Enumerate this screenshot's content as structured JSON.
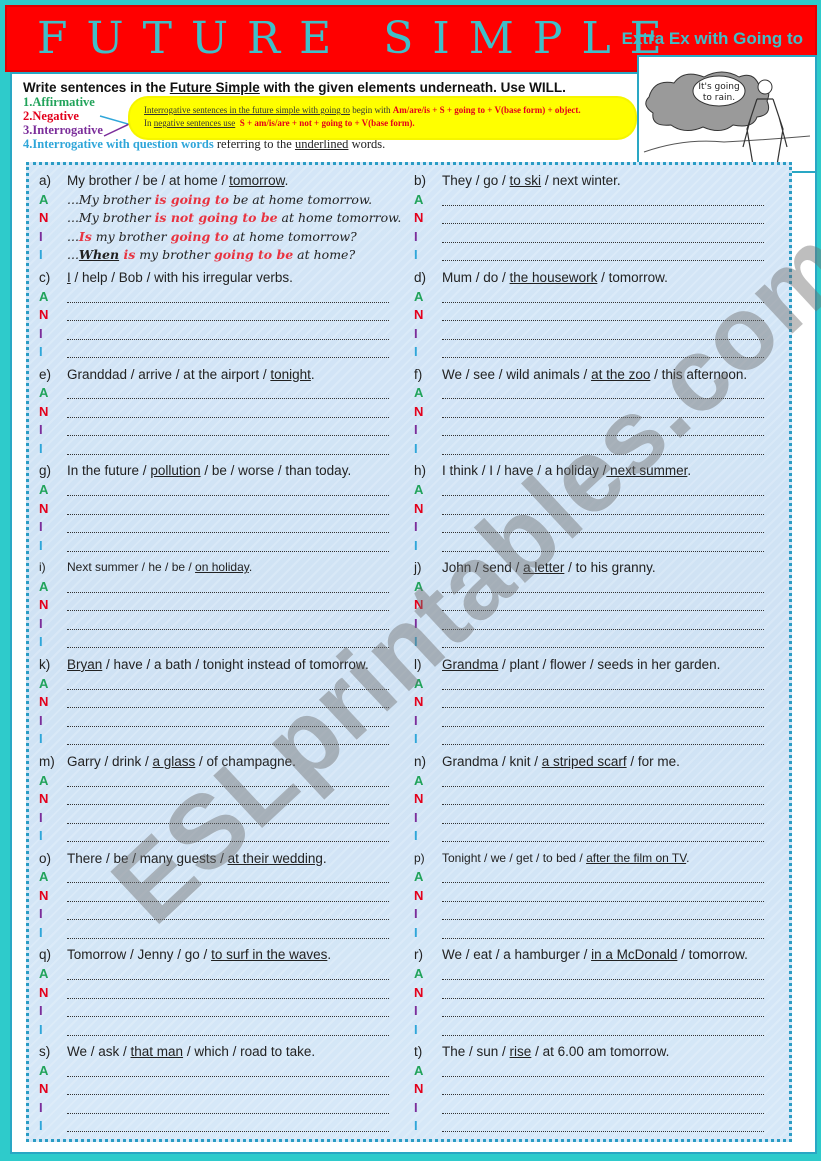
{
  "header": {
    "title": "FUTURE SIMPLE",
    "subtitle": "Extra Ex with Going to"
  },
  "picture": {
    "speech_bubble_line1": "It's going",
    "speech_bubble_line2": "to rain."
  },
  "instructions": {
    "main_prefix": "Write sentences in the ",
    "main_underlined": "Future Simple",
    "main_suffix": " with the given elements underneath. Use WILL.",
    "types": [
      {
        "label": "1.Affirmative",
        "color": "#21a35a"
      },
      {
        "label": "2.Negative",
        "color": "#e3001b"
      },
      {
        "label": "3.Interrogative",
        "color": "#7b2d9a"
      }
    ],
    "type4_label": "4.Interrogative with question words",
    "type4_suffix_pre": " referring to the ",
    "type4_underlined": "underlined",
    "type4_suffix_post": " words."
  },
  "note": {
    "line1_underlined": "Interrogative sentences in the future simple with going to",
    "line1_mid": " begin with ",
    "line1_formula": "Am/are/is + S + going to + V(base form) + object.",
    "line2_prefix": "In ",
    "line2_underlined": "negative sentences use",
    "line2_formula": "S + am/is/are + not + going to + V(base form)."
  },
  "labels": {
    "A": "A",
    "N": "N",
    "I": "I",
    "I2": "I",
    "colors": {
      "A": "#21a35a",
      "N": "#e3001b",
      "I": "#7b2d9a",
      "I2": "#2fa6d9"
    }
  },
  "example": {
    "letter": "a)",
    "prompt_pre": "My brother / be / at home / ",
    "prompt_underlined": "tomorrow",
    "prompt_post": ".",
    "answers": {
      "A": {
        "pre": "...My brother ",
        "red": "is going to",
        "post": " be at home tomorrow."
      },
      "N": {
        "pre": "...My brother ",
        "red": "is not going to be",
        "post": " at home tomorrow."
      },
      "I": {
        "pre": "...",
        "red": "Is",
        "mid": " my brother ",
        "red2": "going to",
        "post": "  at home tomorrow?"
      },
      "I2": {
        "pre": "...",
        "under": "When",
        "red": " is",
        "mid": " my brother ",
        "red2": "going to be",
        "post": " at home?"
      }
    }
  },
  "exercises": [
    {
      "letter": "b)",
      "pre": "They / go / ",
      "underlined": "to ski",
      "post": " / next winter."
    },
    {
      "letter": "c)",
      "pre": "",
      "underlined": "I",
      "post": " / help / Bob / with his irregular verbs."
    },
    {
      "letter": "d)",
      "pre": "Mum / do / ",
      "underlined": "the housework",
      "post": " / tomorrow."
    },
    {
      "letter": "e)",
      "pre": "Granddad / arrive / at the airport / ",
      "underlined": "tonight",
      "post": "."
    },
    {
      "letter": "f)",
      "pre": "We / see / wild animals / ",
      "underlined": "at the zoo",
      "post": " / this afternoon."
    },
    {
      "letter": "g)",
      "pre": "In the future / ",
      "underlined": "pollution",
      "post": " / be / worse / than today."
    },
    {
      "letter": "h)",
      "pre": "I think / I / have / a holiday /",
      "underlined": " next summer",
      "post": "."
    },
    {
      "letter": "i)",
      "pre": "Next summer / he / be / ",
      "underlined": "on holiday",
      "post": ".",
      "small": true
    },
    {
      "letter": "j)",
      "pre": "John / send / ",
      "underlined": "a letter",
      "post": " / to his granny."
    },
    {
      "letter": "k)",
      "pre": "",
      "underlined": "Bryan",
      "post": " / have / a bath / tonight instead of tomorrow."
    },
    {
      "letter": "l)",
      "pre": "",
      "underlined": "Grandma",
      "post": " / plant / flower / seeds in her garden."
    },
    {
      "letter": "m)",
      "pre": "Garry / drink / ",
      "underlined": "a glass",
      "post": " / of champagne."
    },
    {
      "letter": "n)",
      "pre": "Grandma / knit / ",
      "underlined": "a striped scarf",
      "post": " / for me."
    },
    {
      "letter": "o)",
      "pre": "There / be / many guests / ",
      "underlined": "at their wedding",
      "post": "."
    },
    {
      "letter": "p)",
      "pre": "Tonight / we / get / to bed / ",
      "underlined": "after the film on TV",
      "post": ".",
      "small": true
    },
    {
      "letter": "q)",
      "pre": "Tomorrow / Jenny / go / ",
      "underlined": "to surf in the waves",
      "post": "."
    },
    {
      "letter": "r)",
      "pre": "We / eat / a hamburger / ",
      "underlined": "in a McDonald",
      "post": " / tomorrow."
    },
    {
      "letter": "s)",
      "pre": "We / ask / ",
      "underlined": "that man",
      "post": " / which / road to take."
    },
    {
      "letter": "t)",
      "pre": "The / sun / ",
      "underlined": "rise",
      "post": " / at 6.00 am tomorrow."
    }
  ],
  "watermark": "ESLprintables.com"
}
